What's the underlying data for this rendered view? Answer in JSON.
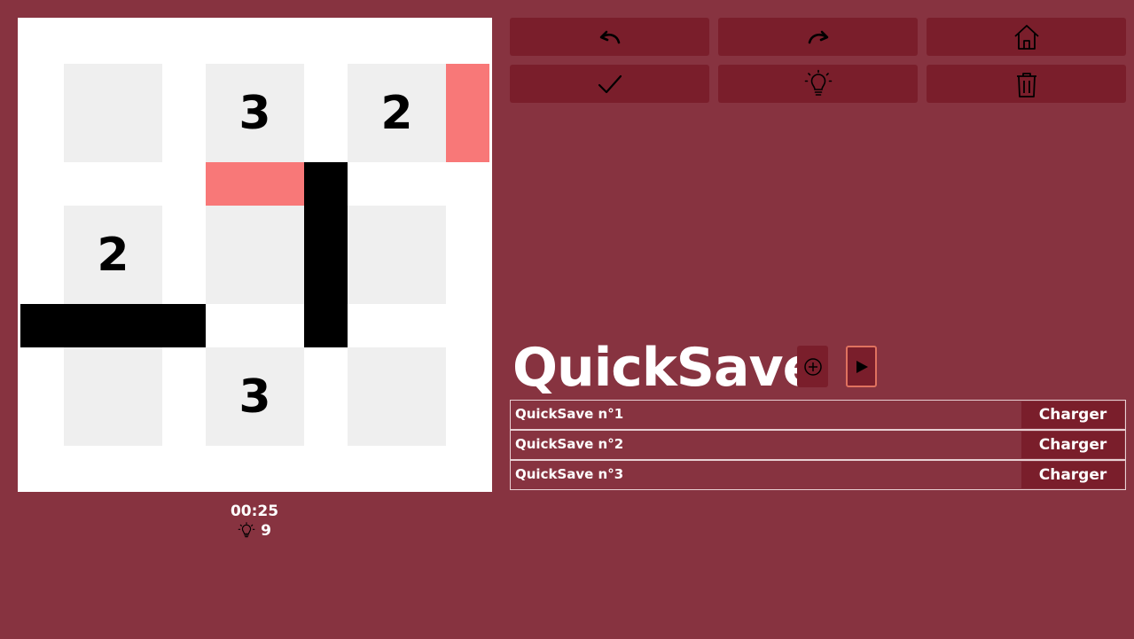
{
  "toolbar": {
    "row1": [
      {
        "name": "undo-button",
        "icon": "undo-icon"
      },
      {
        "name": "redo-button",
        "icon": "redo-icon"
      },
      {
        "name": "home-button",
        "icon": "home-icon"
      }
    ],
    "row2": [
      {
        "name": "check-button",
        "icon": "check-icon"
      },
      {
        "name": "hint-button",
        "icon": "lightbulb-icon"
      },
      {
        "name": "delete-button",
        "icon": "trash-icon"
      }
    ]
  },
  "board": {
    "size": 3,
    "clues": [
      [
        "",
        "3",
        "2"
      ],
      [
        "2",
        "",
        ""
      ],
      [
        "",
        "3",
        ""
      ]
    ]
  },
  "status": {
    "timer": "00:25",
    "hints_remaining": "9"
  },
  "quicksave": {
    "title": "QuickSave",
    "add_icon": "plus-circle-icon",
    "play_icon": "play-icon",
    "slots": [
      {
        "label": "QuickSave n°1",
        "button": "Charger"
      },
      {
        "label": "QuickSave n°2",
        "button": "Charger"
      },
      {
        "label": "QuickSave n°3",
        "button": "Charger"
      }
    ]
  },
  "colors": {
    "background": "#873340",
    "button": "#7a1e2b",
    "cell": "#efefef",
    "edge_marked": "#f87878",
    "edge_line": "#000000",
    "play_border": "#e0725f"
  }
}
